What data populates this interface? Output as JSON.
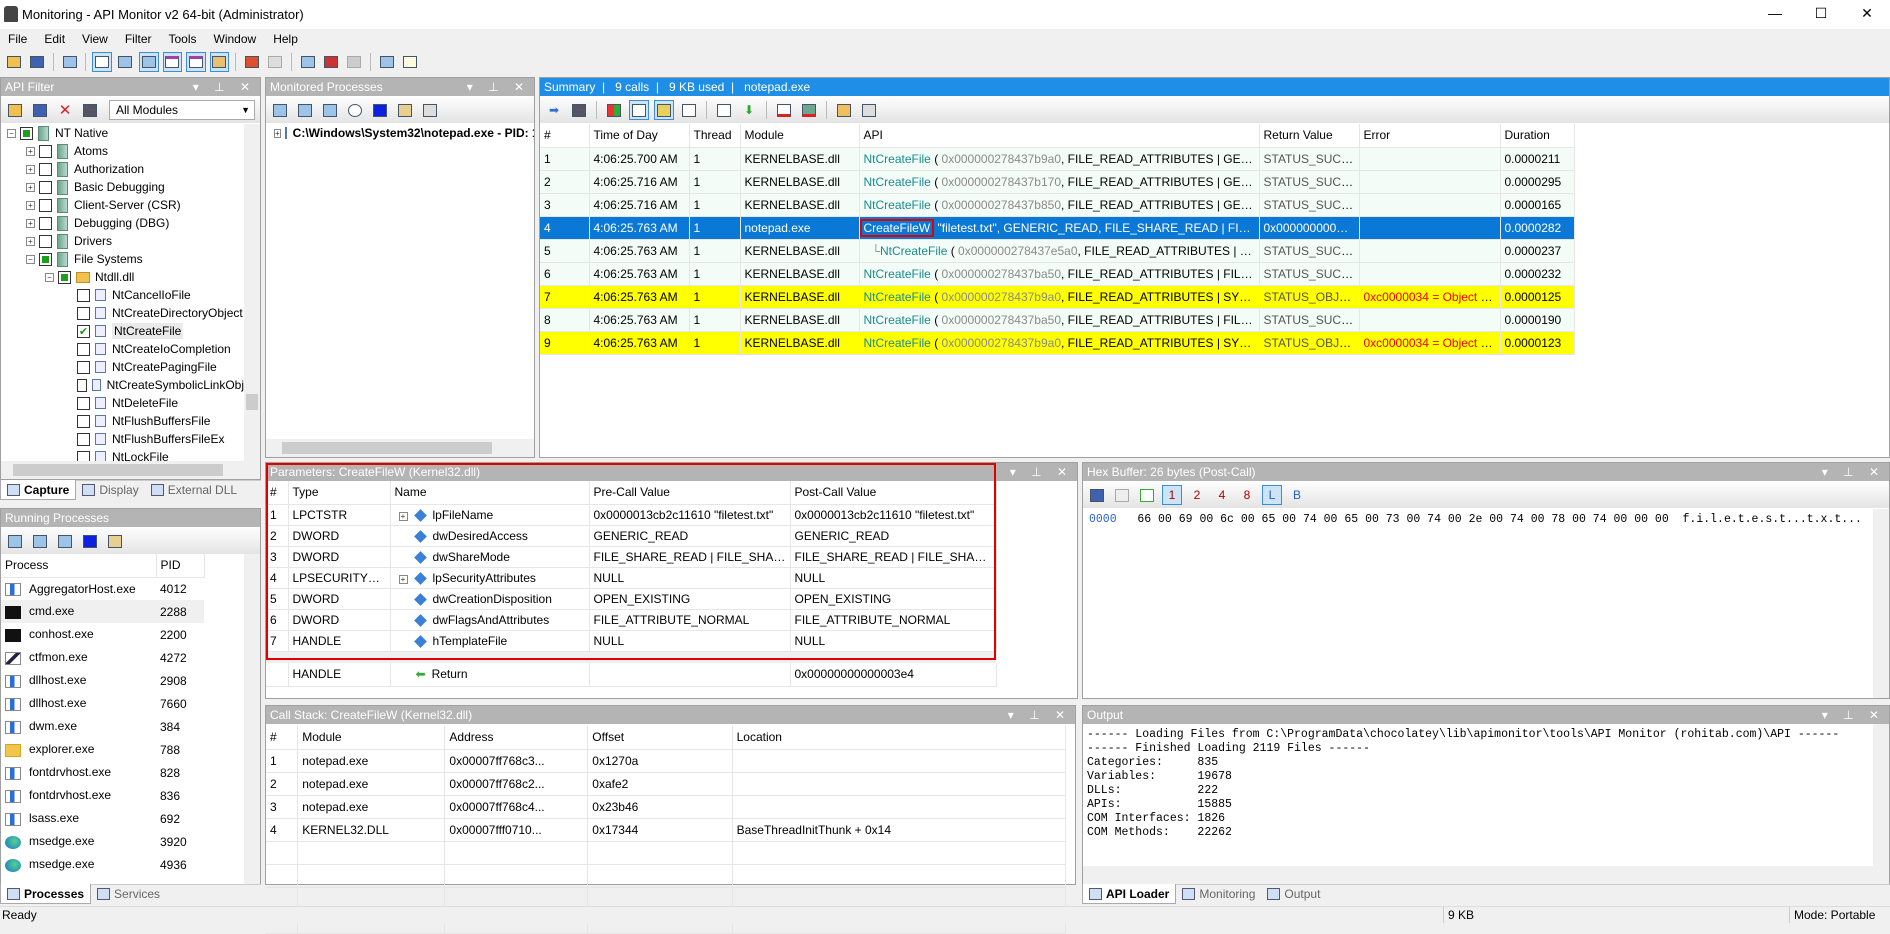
{
  "window": {
    "title": "Monitoring - API Monitor v2 64-bit (Administrator)",
    "minimize": "—",
    "maximize": "☐",
    "close": "✕"
  },
  "menu": [
    "File",
    "Edit",
    "View",
    "Filter",
    "Tools",
    "Window",
    "Help"
  ],
  "api_filter": {
    "title": "API Filter",
    "module_select": "All Modules",
    "tree": [
      {
        "label": "NT Native",
        "level": 0,
        "expander": "-",
        "check": "partial",
        "icon": "book-icon"
      },
      {
        "label": "Atoms",
        "level": 1,
        "expander": "+",
        "check": "none",
        "icon": "book-icon"
      },
      {
        "label": "Authorization",
        "level": 1,
        "expander": "+",
        "check": "none",
        "icon": "book-icon"
      },
      {
        "label": "Basic Debugging",
        "level": 1,
        "expander": "+",
        "check": "none",
        "icon": "book-icon"
      },
      {
        "label": "Client-Server (CSR)",
        "level": 1,
        "expander": "+",
        "check": "none",
        "icon": "book-icon"
      },
      {
        "label": "Debugging (DBG)",
        "level": 1,
        "expander": "+",
        "check": "none",
        "icon": "book-icon"
      },
      {
        "label": "Drivers",
        "level": 1,
        "expander": "+",
        "check": "none",
        "icon": "book-icon"
      },
      {
        "label": "File Systems",
        "level": 1,
        "expander": "-",
        "check": "partial",
        "icon": "book-icon"
      },
      {
        "label": "Ntdll.dll",
        "level": 2,
        "expander": "-",
        "check": "partial",
        "icon": "folder-icon"
      },
      {
        "label": "NtCancelIoFile",
        "level": 3,
        "check": "none",
        "icon": "api-icon"
      },
      {
        "label": "NtCreateDirectoryObject",
        "level": 3,
        "check": "none",
        "icon": "api-icon"
      },
      {
        "label": "NtCreateFile",
        "level": 3,
        "check": "checked",
        "icon": "api-icon",
        "selected": true
      },
      {
        "label": "NtCreateIoCompletion",
        "level": 3,
        "check": "none",
        "icon": "api-icon"
      },
      {
        "label": "NtCreatePagingFile",
        "level": 3,
        "check": "none",
        "icon": "api-icon"
      },
      {
        "label": "NtCreateSymbolicLinkObj",
        "level": 3,
        "check": "none",
        "icon": "api-icon"
      },
      {
        "label": "NtDeleteFile",
        "level": 3,
        "check": "none",
        "icon": "api-icon"
      },
      {
        "label": "NtFlushBuffersFile",
        "level": 3,
        "check": "none",
        "icon": "api-icon"
      },
      {
        "label": "NtFlushBuffersFileEx",
        "level": 3,
        "check": "none",
        "icon": "api-icon"
      },
      {
        "label": "NtLockFile",
        "level": 3,
        "check": "none",
        "icon": "api-icon"
      }
    ],
    "tabs": [
      "Capture",
      "Display",
      "External DLL"
    ]
  },
  "running_processes": {
    "title": "Running Processes",
    "columns": [
      "Process",
      "PID"
    ],
    "rows": [
      {
        "name": "AggregatorHost.exe",
        "pid": "4012",
        "icon": "window"
      },
      {
        "name": "cmd.exe",
        "pid": "2288",
        "icon": "cmd"
      },
      {
        "name": "conhost.exe",
        "pid": "2200",
        "icon": "cmd"
      },
      {
        "name": "ctfmon.exe",
        "pid": "4272",
        "icon": "pen"
      },
      {
        "name": "dllhost.exe",
        "pid": "2908",
        "icon": "window"
      },
      {
        "name": "dllhost.exe",
        "pid": "7660",
        "icon": "window"
      },
      {
        "name": "dwm.exe",
        "pid": "384",
        "icon": "window"
      },
      {
        "name": "explorer.exe",
        "pid": "788",
        "icon": "folder"
      },
      {
        "name": "fontdrvhost.exe",
        "pid": "828",
        "icon": "window"
      },
      {
        "name": "fontdrvhost.exe",
        "pid": "836",
        "icon": "window"
      },
      {
        "name": "lsass.exe",
        "pid": "692",
        "icon": "window"
      },
      {
        "name": "msedge.exe",
        "pid": "3920",
        "icon": "edge"
      },
      {
        "name": "msedge.exe",
        "pid": "4936",
        "icon": "edge"
      }
    ],
    "tabs": [
      "Processes",
      "Services"
    ]
  },
  "monitored_processes": {
    "title": "Monitored Processes",
    "items": [
      "C:\\Windows\\System32\\notepad.exe - PID: 1"
    ]
  },
  "summary": {
    "title": "Summary",
    "calls": "9 calls",
    "used": "9 KB used",
    "process": "notepad.exe",
    "columns": [
      "#",
      "Time of Day",
      "Thread",
      "Module",
      "API",
      "Return Value",
      "Error",
      "Duration"
    ],
    "rows": [
      {
        "n": "1",
        "time": "4:06:25.700 AM",
        "thread": "1",
        "module": "KERNELBASE.dll",
        "api": "NtCreateFile",
        "open": " ( ",
        "arg1": "0x000000278437b9a0",
        "rest": ", FILE_READ_ATTRIBUTES | GENERIC_RE...",
        "ret": "STATUS_SUCCESS",
        "err": "",
        "dur": "0.0000211",
        "style": "row"
      },
      {
        "n": "2",
        "time": "4:06:25.716 AM",
        "thread": "1",
        "module": "KERNELBASE.dll",
        "api": "NtCreateFile",
        "open": " ( ",
        "arg1": "0x000000278437b170",
        "rest": ", FILE_READ_ATTRIBUTES | GENERIC_RE...",
        "ret": "STATUS_SUCCESS",
        "err": "",
        "dur": "0.0000295",
        "style": "row"
      },
      {
        "n": "3",
        "time": "4:06:25.716 AM",
        "thread": "1",
        "module": "KERNELBASE.dll",
        "api": "NtCreateFile",
        "open": " ( ",
        "arg1": "0x000000278437b850",
        "rest": ", FILE_READ_ATTRIBUTES | GENERIC_RE...",
        "ret": "STATUS_SUCCESS",
        "err": "",
        "dur": "0.0000165",
        "style": "row"
      },
      {
        "n": "4",
        "time": "4:06:25.763 AM",
        "thread": "1",
        "module": "notepad.exe",
        "api": "CreateFileW",
        "open": " ",
        "arg1": "",
        "rest": "\"filetest.txt\", GENERIC_READ, FILE_SHARE_READ | FILE_SHAR...",
        "ret": "0x00000000000...",
        "err": "",
        "dur": "0.0000282",
        "style": "sel"
      },
      {
        "n": "5",
        "time": "4:06:25.763 AM",
        "thread": "1",
        "module": "KERNELBASE.dll",
        "api": "NtCreateFile",
        "open": " ( ",
        "arg1": "0x000000278437e5a0",
        "rest": ", FILE_READ_ATTRIBUTES | GENERIC...",
        "ret": "STATUS_SUCCESS",
        "err": "",
        "dur": "0.0000237",
        "style": "row",
        "child": true
      },
      {
        "n": "6",
        "time": "4:06:25.763 AM",
        "thread": "1",
        "module": "KERNELBASE.dll",
        "api": "NtCreateFile",
        "open": " ( ",
        "arg1": "0x000000278437ba50",
        "rest": ", FILE_READ_ATTRIBUTES | FILE_READ_D...",
        "ret": "STATUS_SUCCESS",
        "err": "",
        "dur": "0.0000232",
        "style": "row"
      },
      {
        "n": "7",
        "time": "4:06:25.763 AM",
        "thread": "1",
        "module": "KERNELBASE.dll",
        "api": "NtCreateFile",
        "open": " ( ",
        "arg1": "0x000000278437b9a0",
        "rest": ", FILE_READ_ATTRIBUTES | SYNCHRONIZE,",
        "ret": "STATUS_OBJEC...",
        "err": "0xc0000034 = Object N...",
        "dur": "0.0000125",
        "style": "yellow"
      },
      {
        "n": "8",
        "time": "4:06:25.763 AM",
        "thread": "1",
        "module": "KERNELBASE.dll",
        "api": "NtCreateFile",
        "open": " ( ",
        "arg1": "0x000000278437ba50",
        "rest": ", FILE_READ_ATTRIBUTES | FILE_READ_D...",
        "ret": "STATUS_SUCCESS",
        "err": "",
        "dur": "0.0000190",
        "style": "row"
      },
      {
        "n": "9",
        "time": "4:06:25.763 AM",
        "thread": "1",
        "module": "KERNELBASE.dll",
        "api": "NtCreateFile",
        "open": " ( ",
        "arg1": "0x000000278437b9a0",
        "rest": ", FILE_READ_ATTRIBUTES | SYNCHRONIZE,",
        "ret": "STATUS_OBJEC...",
        "err": "0xc0000034 = Object N...",
        "dur": "0.0000123",
        "style": "yellow"
      }
    ]
  },
  "parameters": {
    "title": "Parameters: CreateFileW (Kernel32.dll)",
    "columns": [
      "#",
      "Type",
      "Name",
      "Pre-Call Value",
      "Post-Call Value"
    ],
    "rows": [
      {
        "n": "1",
        "type": "LPCTSTR",
        "name": "lpFileName",
        "expand": true,
        "pre": "0x0000013cb2c11610 \"filetest.txt\"",
        "post": "0x0000013cb2c11610 \"filetest.txt\""
      },
      {
        "n": "2",
        "type": "DWORD",
        "name": "dwDesiredAccess",
        "pre": "GENERIC_READ",
        "post": "GENERIC_READ"
      },
      {
        "n": "3",
        "type": "DWORD",
        "name": "dwShareMode",
        "pre": "FILE_SHARE_READ | FILE_SHARE_W...",
        "post": "FILE_SHARE_READ | FILE_SHARE_W..."
      },
      {
        "n": "4",
        "type": "LPSECURITY_ATTRIBUTES",
        "name": "lpSecurityAttributes",
        "expand": true,
        "pre": "NULL",
        "post": "NULL"
      },
      {
        "n": "5",
        "type": "DWORD",
        "name": "dwCreationDisposition",
        "pre": "OPEN_EXISTING",
        "post": "OPEN_EXISTING"
      },
      {
        "n": "6",
        "type": "DWORD",
        "name": "dwFlagsAndAttributes",
        "pre": "FILE_ATTRIBUTE_NORMAL",
        "post": "FILE_ATTRIBUTE_NORMAL"
      },
      {
        "n": "7",
        "type": "HANDLE",
        "name": "hTemplateFile",
        "pre": "NULL",
        "post": "NULL"
      }
    ],
    "return": {
      "type": "HANDLE",
      "name": "Return",
      "pre": "",
      "post": "0x00000000000003e4"
    }
  },
  "hex_buffer": {
    "title": "Hex Buffer: 26 bytes (Post-Call)",
    "offset": "0000",
    "bytes": "66 00 69 00 6c 00 65 00 74 00 65 00 73 00 74 00 2e 00 74 00 78 00 74 00 00 00",
    "ascii": "f.i.l.e.t.e.s.t...t.x.t..."
  },
  "call_stack": {
    "title": "Call Stack: CreateFileW (Kernel32.dll)",
    "columns": [
      "#",
      "Module",
      "Address",
      "Offset",
      "Location"
    ],
    "rows": [
      {
        "n": "1",
        "module": "notepad.exe",
        "address": "0x00007ff768c3...",
        "offset": "0x1270a",
        "location": ""
      },
      {
        "n": "2",
        "module": "notepad.exe",
        "address": "0x00007ff768c2...",
        "offset": "0xafe2",
        "location": ""
      },
      {
        "n": "3",
        "module": "notepad.exe",
        "address": "0x00007ff768c4...",
        "offset": "0x23b46",
        "location": ""
      },
      {
        "n": "4",
        "module": "KERNEL32.DLL",
        "address": "0x00007fff0710...",
        "offset": "0x17344",
        "location": "BaseThreadInitThunk + 0x14"
      }
    ]
  },
  "output": {
    "title": "Output",
    "lines": [
      "------ Loading Files from C:\\ProgramData\\chocolatey\\lib\\apimonitor\\tools\\API Monitor (rohitab.com)\\API ------",
      "------ Finished Loading 2119 Files ------",
      "Categories:     835",
      "Variables:      19678",
      "DLLs:           222",
      "APIs:           15885",
      "COM Interfaces: 1826",
      "COM Methods:    22262"
    ],
    "tabs": [
      "API Loader",
      "Monitoring",
      "Output"
    ]
  },
  "status": {
    "left": "Ready",
    "size": "9 KB",
    "mode": "Mode: Portable"
  },
  "colors": {
    "selection": "#0a78d7",
    "error_row": "#ffff00",
    "error_text": "#f00000",
    "api_name": "#1a8a8f",
    "highlight_border": "#e00000",
    "summary_bar": "#1e8ee6"
  }
}
